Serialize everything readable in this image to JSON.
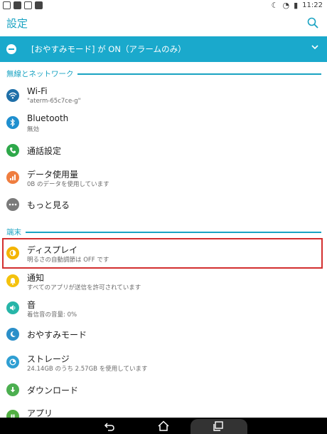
{
  "status_bar": {
    "time": "11:22"
  },
  "app_bar": {
    "title": "設定"
  },
  "banner": {
    "text": "[おやすみモード] が ON（アラームのみ）"
  },
  "sections": [
    {
      "title": "無線とネットワーク"
    },
    {
      "title": "端末"
    }
  ],
  "items": [
    {
      "label": "Wi-Fi",
      "sub": "\"aterm-65c7ce-g\""
    },
    {
      "label": "Bluetooth",
      "sub": "無効"
    },
    {
      "label": "通話設定",
      "sub": ""
    },
    {
      "label": "データ使用量",
      "sub": "0B のデータを使用しています"
    },
    {
      "label": "もっと見る",
      "sub": ""
    },
    {
      "label": "ディスプレイ",
      "sub": "明るさの自動調節は OFF です"
    },
    {
      "label": "通知",
      "sub": "すべてのアプリが送信を許可されています"
    },
    {
      "label": "音",
      "sub": "着信音の音量: 0%"
    },
    {
      "label": "おやすみモード",
      "sub": ""
    },
    {
      "label": "ストレージ",
      "sub": "24.14GB のうち 2.57GB を使用しています"
    },
    {
      "label": "ダウンロード",
      "sub": ""
    },
    {
      "label": "アプリ",
      "sub": ""
    }
  ],
  "colors": {
    "accent": "#1aa3c2",
    "banner": "#1aa9cc",
    "wifi": "#1f6fa8",
    "bluetooth": "#1f8fcf",
    "call": "#2ea84a",
    "data": "#ef7d3f",
    "more": "#7a7a7a",
    "display": "#f4b400",
    "notify": "#f4c20d",
    "sound": "#27b5a8",
    "dnd": "#2b8fc9",
    "storage": "#2f9fd3",
    "download": "#4caf50",
    "apps": "#52b043",
    "highlight": "#d32f2f"
  }
}
